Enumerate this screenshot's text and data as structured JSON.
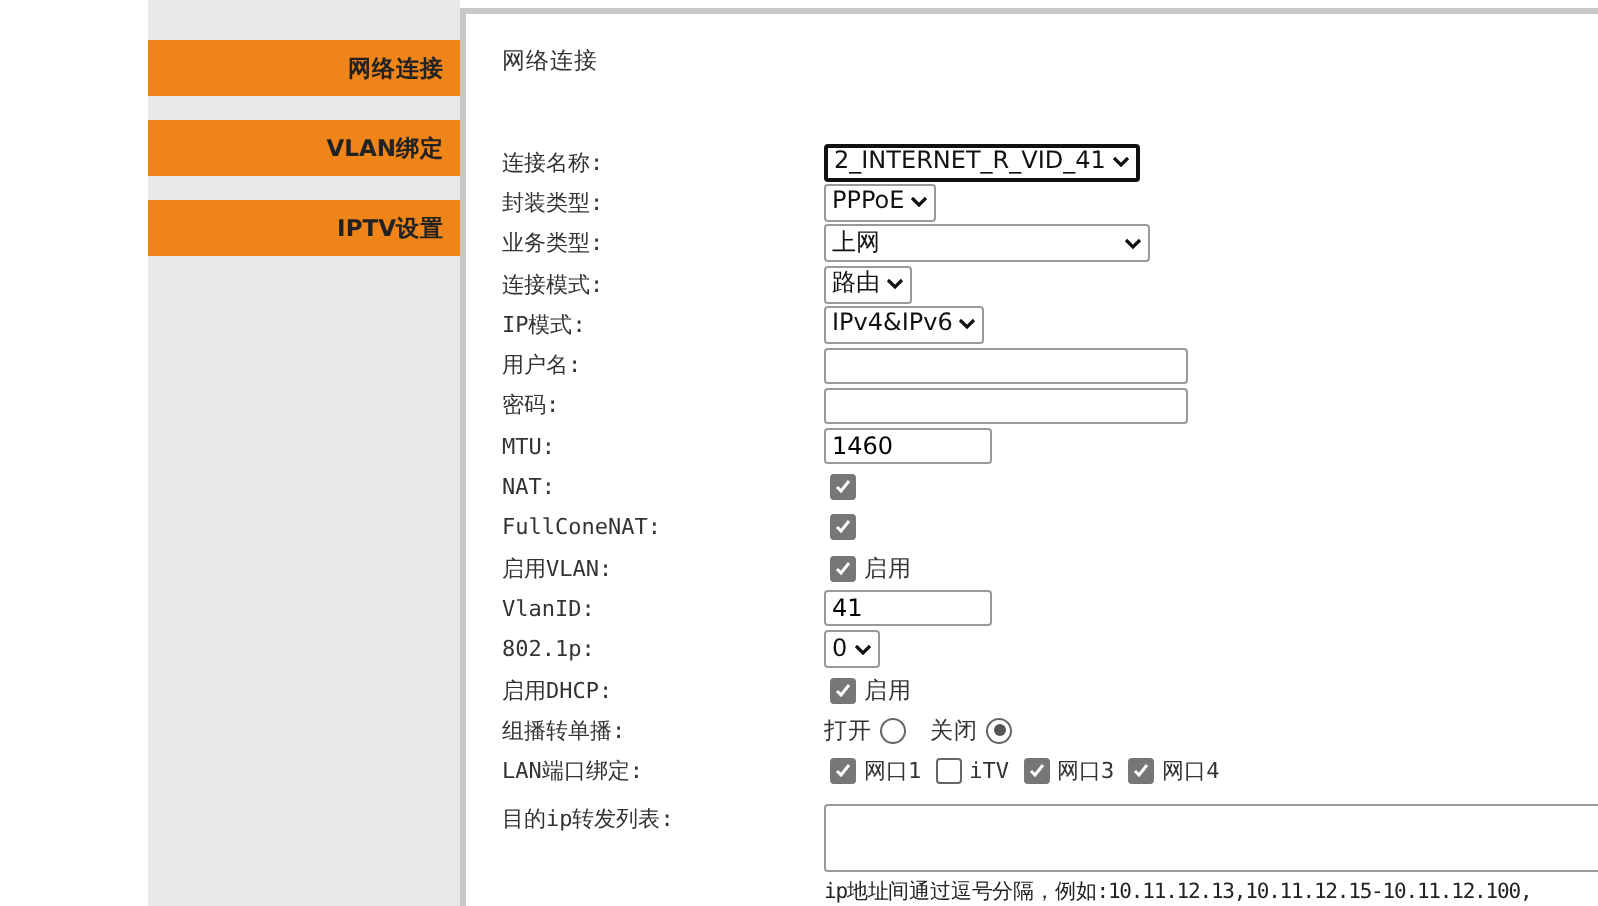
{
  "sidebar": {
    "items": [
      {
        "label": "网络连接"
      },
      {
        "label": "VLAN绑定"
      },
      {
        "label": "IPTV设置"
      }
    ]
  },
  "panel": {
    "title": "网络连接",
    "rows": [
      {
        "kind": "select",
        "label": "连接名称:",
        "value": "2_INTERNET_R_VID_41",
        "focused": true,
        "wide": false
      },
      {
        "kind": "select",
        "label": "封装类型:",
        "value": "PPPoE",
        "focused": false,
        "wide": false
      },
      {
        "kind": "select",
        "label": "业务类型:",
        "value": "上网",
        "focused": false,
        "wide": true
      },
      {
        "kind": "select",
        "label": "连接模式:",
        "value": "路由",
        "focused": false,
        "wide": false
      },
      {
        "kind": "select",
        "label": "IP模式:",
        "value": "IPv4&IPv6",
        "focused": false,
        "wide": false
      },
      {
        "kind": "text",
        "label": "用户名:",
        "wide": true
      },
      {
        "kind": "text",
        "label": "密码:",
        "wide": true
      },
      {
        "kind": "text",
        "label": "MTU:",
        "value": "1460",
        "wide": false
      },
      {
        "kind": "checkbox",
        "label": "NAT:",
        "checked": true
      },
      {
        "kind": "checkbox",
        "label": "FullConeNAT:",
        "checked": true
      },
      {
        "kind": "checkbox",
        "label": "启用VLAN:",
        "checked": true,
        "text": "启用"
      },
      {
        "kind": "text",
        "label": "VlanID:",
        "value": "41",
        "wide": false
      },
      {
        "kind": "select",
        "label": "802.1p:",
        "value": "0",
        "focused": false,
        "wide": false
      },
      {
        "kind": "checkbox",
        "label": "启用DHCP:",
        "checked": true,
        "text": "启用"
      },
      {
        "kind": "radio",
        "label": "组播转单播:",
        "options": [
          {
            "label": "打开",
            "selected": false
          },
          {
            "label": "关闭",
            "selected": true
          }
        ]
      },
      {
        "kind": "checkgroup",
        "label": "LAN端口绑定:",
        "options": [
          {
            "label": "网口1",
            "checked": true
          },
          {
            "label": "iTV",
            "checked": false
          },
          {
            "label": "网口3",
            "checked": true
          },
          {
            "label": "网口4",
            "checked": true
          }
        ]
      },
      {
        "kind": "textarea",
        "label": "目的ip转发列表:",
        "hint": "ip地址间通过逗号分隔，例如:10.11.12.13,10.11.12.15-10.11.12.100,"
      }
    ]
  }
}
